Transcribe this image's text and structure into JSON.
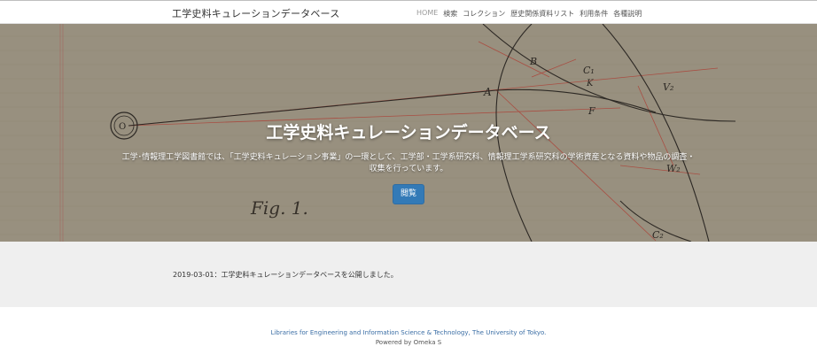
{
  "site": {
    "brand": "工学史料キュレーションデータベース"
  },
  "nav": {
    "items": [
      {
        "label": "HOME",
        "active": true
      },
      {
        "label": "検索",
        "active": false
      },
      {
        "label": "コレクション",
        "active": false
      },
      {
        "label": "歴史関係資料リスト",
        "active": false
      },
      {
        "label": "利用条件",
        "active": false
      },
      {
        "label": "各種説明",
        "active": false
      }
    ]
  },
  "hero": {
    "title": "工学史料キュレーションデータベース",
    "description": "工学･情報理工学図書館では、「工学史料キュレーション事業」の一環として、工学部・工学系研究科、情報理工学系研究科の学術資産となる資料や物品の調査・収集を行っています。",
    "button_label": "閲覧",
    "image_labels": {
      "fig": "Fig. 1.",
      "a": "A",
      "b": "B",
      "c1": "C₁",
      "k": "K",
      "f": "F",
      "v2": "V₂",
      "w2": "W₂",
      "c2": "C₂",
      "o": "O"
    }
  },
  "news": {
    "items": [
      {
        "text": "2019-03-01：工学史料キュレーションデータベースを公開しました。"
      }
    ]
  },
  "footer": {
    "link_text": "Libraries for Engineering and Information Science & Technology, The University of Tokyo.",
    "powered": "Powered by Omeka S"
  },
  "colors": {
    "accent": "#337ab7",
    "hero_bg": "#a19886",
    "news_bg": "#efefef",
    "footer_link": "#3b6ea5"
  }
}
